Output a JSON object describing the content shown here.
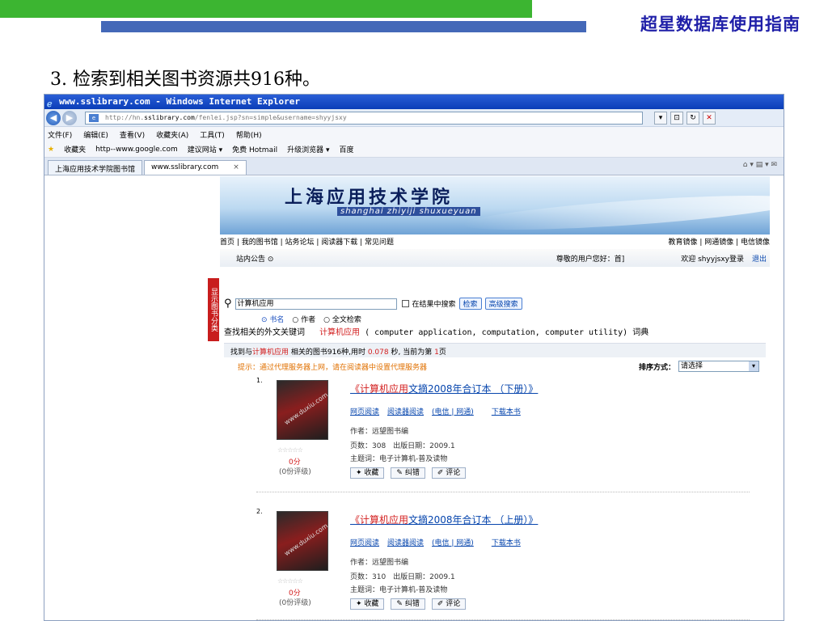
{
  "slide": {
    "title": "超星数据库使用指南",
    "heading": "3. 检索到相关图书资源共916种。"
  },
  "browser": {
    "title": "www.sslibrary.com - Windows Internet Explorer",
    "url_prefix": "http://hn.",
    "url_domain": "sslibrary.com",
    "url_rest": "/fenlei.jsp?sn=simple&username=shyyjsxy",
    "menu": [
      "文件(F)",
      "编辑(E)",
      "查看(V)",
      "收藏夹(A)",
      "工具(T)",
      "帮助(H)"
    ],
    "favorites": [
      "收藏夹",
      "http--www.google.com",
      "建议网站 ▾",
      "免费 Hotmail",
      "升级浏览器 ▾",
      "百度"
    ],
    "tabs": [
      "上海应用技术学院图书馆",
      "www.sslibrary.com"
    ],
    "tab_close": "×"
  },
  "site": {
    "name": "上海应用技术学院",
    "pinyin": "shanghai zhiyiji shuxueyuan",
    "nav_left": "首页 | 我的图书馆 | 站务论坛 | 阅读器下载 | 常见问题",
    "nav_right": "教育镜像 | 网通镜像 | 电信镜像",
    "notice": "站内公告 ⊙",
    "greeting": "尊敬的用户您好：首]",
    "welcome": "欢迎 shyyjsxy登录",
    "logout": "退出",
    "side_tab": "显示图书分类"
  },
  "search": {
    "query": "计算机应用",
    "in_results": "在结果中搜索",
    "search_btn": "检索",
    "advanced_btn": "高级搜索",
    "radio_options": [
      "⊙ 书名",
      "○ 作者",
      "○ 全文检索"
    ],
    "related_label": "查找相关的外文关键词",
    "related_kw": "计算机应用",
    "related_terms": "( computer application, computation, computer utility)",
    "dict": "词典"
  },
  "results": {
    "prefix": "找到与",
    "keyword": "计算机应用",
    "mid": "相关的图书916种,用时",
    "time": "0.078",
    "mid2": "秒, 当前为第",
    "page": "1",
    "suffix": "页",
    "tip": "提示：通过代理服务器上网，请在阅读器中设置代理服务器",
    "sort_label": "排序方式：",
    "sort_value": "请选择"
  },
  "books": [
    {
      "index": "1.",
      "title_kw": "《计算机应用",
      "title_rest": "文摘2008年合订本 （下册）》",
      "links": [
        "网页阅读",
        "阅读器阅读",
        "(电信 | 网通)",
        "下载本书"
      ],
      "author": "作者：远望图书编",
      "pages": "页数：308　出版日期：2009.1",
      "subject": "主题词：电子计算机-普及读物",
      "stars": "☆☆☆☆☆",
      "score": "0分",
      "count": "(0份评级)",
      "actions": [
        "收藏",
        "纠错",
        "评论"
      ]
    },
    {
      "index": "2.",
      "title_kw": "《计算机应用",
      "title_rest": "文摘2008年合订本 （上册）》",
      "links": [
        "网页阅读",
        "阅读器阅读",
        "(电信 | 网通)",
        "下载本书"
      ],
      "author": "作者：远望图书编",
      "pages": "页数：310　出版日期：2009.1",
      "subject": "主题词：电子计算机-普及读物",
      "stars": "☆☆☆☆☆",
      "score": "0分",
      "count": "(0份评级)",
      "actions": [
        "收藏",
        "纠错",
        "评论"
      ]
    }
  ]
}
